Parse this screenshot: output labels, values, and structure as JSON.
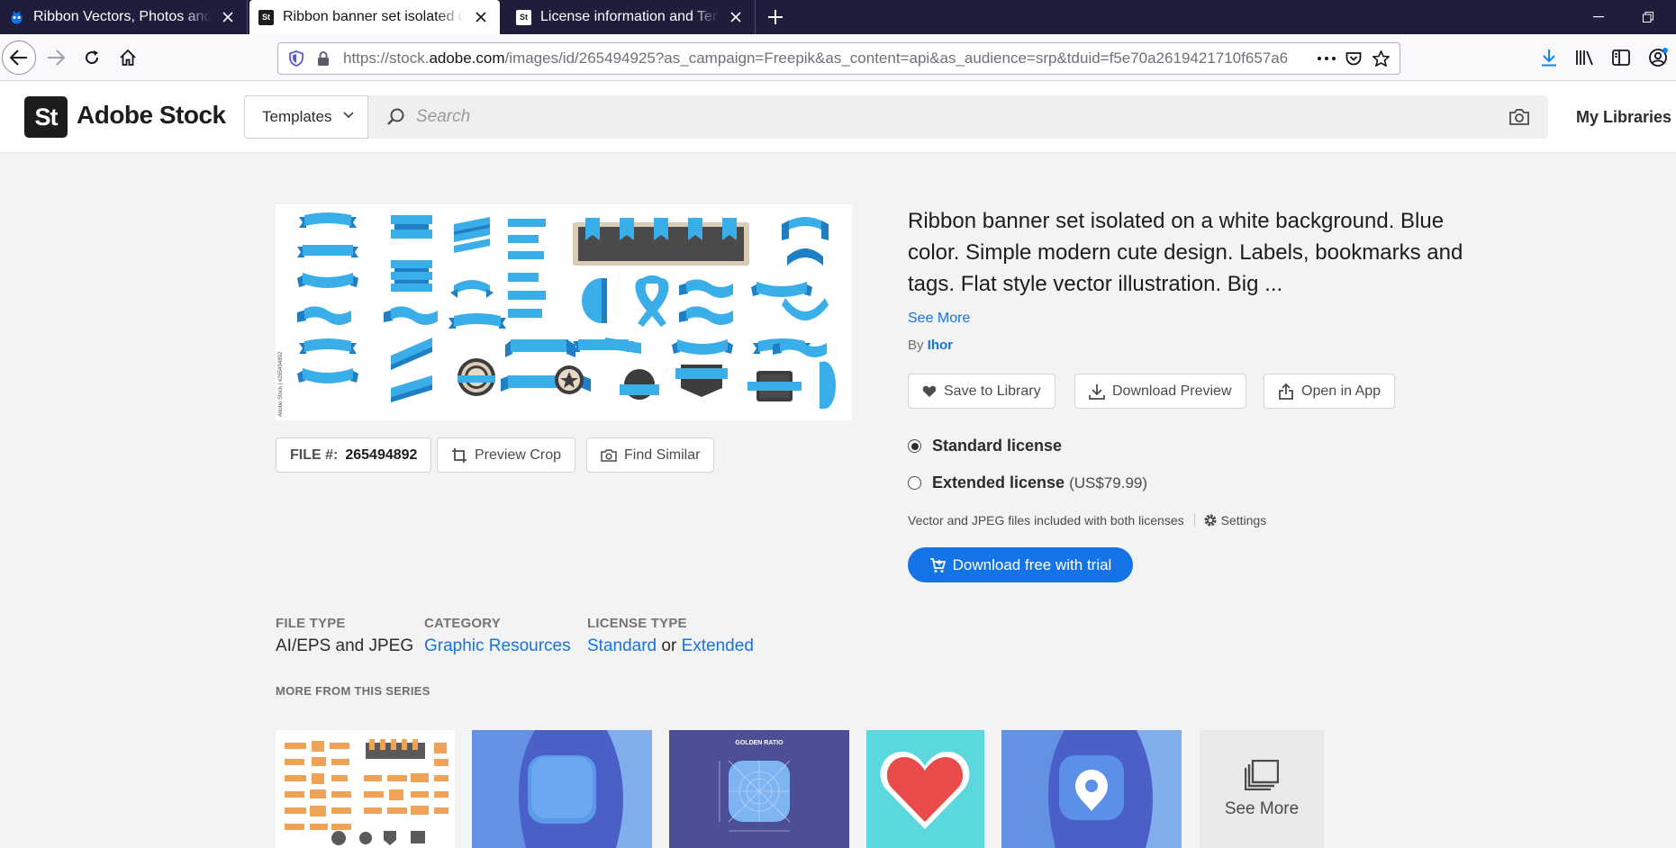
{
  "browser": {
    "tabs": [
      {
        "title": "Ribbon Vectors, Photos and PSD",
        "favicon": "freepik-icon",
        "active": false
      },
      {
        "title": "Ribbon banner set isolated on a",
        "favicon": "adobe-stock-icon",
        "active": true
      },
      {
        "title": "License information and Terms",
        "favicon": "adobe-stock-icon",
        "active": false
      }
    ],
    "url_prefix": "https://stock.",
    "url_domain": "adobe.com",
    "url_rest": "/images/id/265494925?as_campaign=Freepik&as_content=api&as_audience=srp&tduid=f5e70a2619421710f657a6"
  },
  "header": {
    "logo_mark": "St",
    "logo_text": "Adobe Stock",
    "templates_label": "Templates",
    "search_placeholder": "Search",
    "my_libraries": "My Libraries"
  },
  "asset": {
    "description": "Ribbon banner set isolated on a white background. Blue color. Simple modern cute design. Labels, bookmarks and tags. Flat style vector illustration. Big ...",
    "see_more": "See More",
    "by_label": "By",
    "author": "Ihor",
    "watermark": "Adobe Stock | #265494892",
    "file_label": "FILE #:",
    "file_number": "265494892",
    "preview_crop": "Preview Crop",
    "find_similar": "Find Similar",
    "save_to_library": "Save to Library",
    "download_preview": "Download Preview",
    "open_in_app": "Open in App"
  },
  "licenses": {
    "standard": {
      "name": "Standard license",
      "selected": true
    },
    "extended": {
      "name": "Extended license",
      "price": "(US$79.99)",
      "selected": false
    },
    "note": "Vector and JPEG files included with both licenses",
    "settings": "Settings",
    "cta": "Download free with trial"
  },
  "meta": {
    "file_type_label": "FILE TYPE",
    "file_type_value": "AI/EPS and JPEG",
    "category_label": "CATEGORY",
    "category_value": "Graphic Resources",
    "license_type_label": "LICENSE TYPE",
    "license_standard": "Standard",
    "license_or": "or",
    "license_extended": "Extended"
  },
  "series": {
    "title": "MORE FROM THIS SERIES",
    "golden_ratio": "GOLDEN RATIO",
    "see_more": "See More"
  },
  "colors": {
    "accent": "#1473e6",
    "ribbon_blue": "#39aee8",
    "ribbon_dark": "#1e7fc4",
    "tabbar": "#1e1e3c"
  }
}
